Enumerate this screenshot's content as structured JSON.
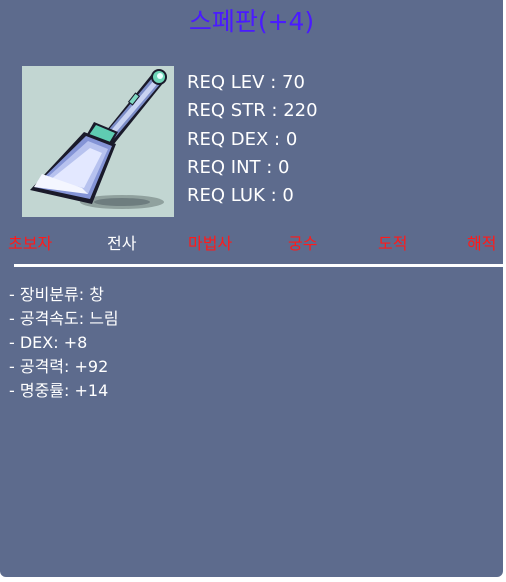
{
  "item": {
    "name": "스페판(+4)",
    "icon": "spear-icon"
  },
  "requirements": [
    "REQ LEV : 70",
    "REQ STR : 220",
    "REQ DEX : 0",
    "REQ INT : 0",
    "REQ LUK : 0"
  ],
  "jobs": [
    {
      "label": "초보자",
      "color": "#ff1a1a"
    },
    {
      "label": "전사",
      "color": "#ffffff"
    },
    {
      "label": "마법사",
      "color": "#ff1a1a"
    },
    {
      "label": "궁수",
      "color": "#ff1a1a"
    },
    {
      "label": "도적",
      "color": "#ff1a1a"
    },
    {
      "label": "해적",
      "color": "#ff1a1a"
    }
  ],
  "stats": [
    "- 장비분류: 창",
    "- 공격속도: 느림",
    "- DEX: +8",
    "- 공격력: +92",
    "- 명중률: +14"
  ],
  "colors": {
    "background": "#5d6b8d",
    "title": "#4a1bff",
    "unavailable_job": "#ff1a1a",
    "available_job": "#ffffff"
  }
}
